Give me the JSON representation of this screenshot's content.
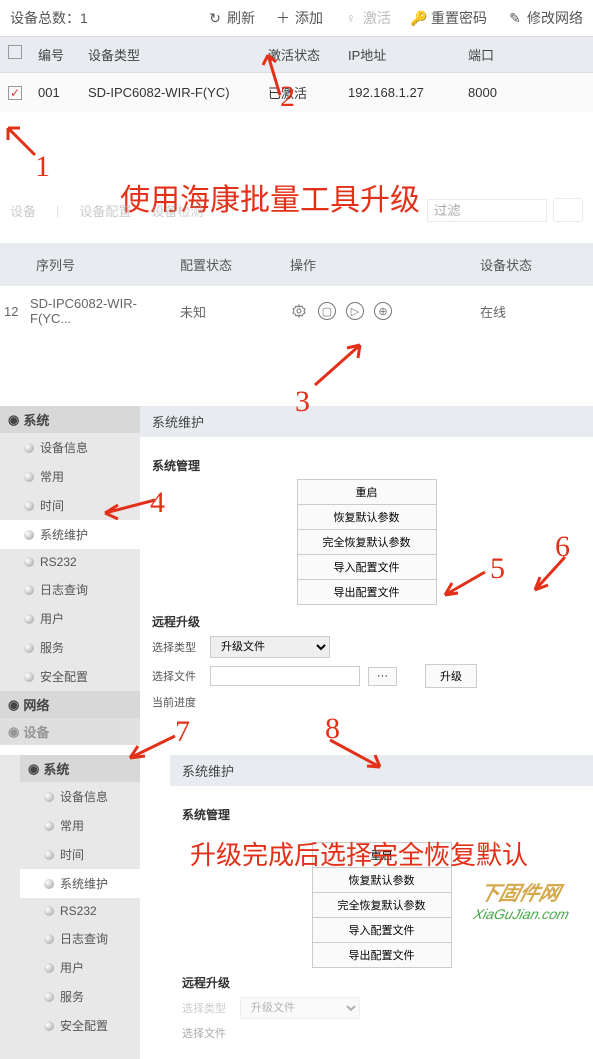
{
  "section1": {
    "total_label": "设备总数：",
    "total_value": "1",
    "toolbar": {
      "refresh": "刷新",
      "add": "添加",
      "activate": "激活",
      "reset_pwd": "重置密码",
      "modify_net": "修改网络"
    },
    "headers": {
      "num": "编号",
      "type": "设备类型",
      "status": "激活状态",
      "ip": "IP地址",
      "port": "端口"
    },
    "row": {
      "num": "001",
      "type": "SD-IPC6082-WIR-F(YC)",
      "status": "已激活",
      "ip": "192.168.1.27",
      "port": "8000"
    }
  },
  "annotations": {
    "title1": "使用海康批量工具升级",
    "title2": "升级完成后选择完全恢复默认",
    "n1": "1",
    "n2": "2",
    "n3": "3",
    "n4": "4",
    "n5": "5",
    "n6": "6",
    "n7": "7",
    "n8": "8"
  },
  "section2": {
    "toolbar": {
      "item1": "设备",
      "item2": "设备",
      "item3": "设备配置",
      "item4": "设备检测",
      "filter_label": "过滤"
    },
    "headers": {
      "serial": "序列号",
      "cfg": "配置状态",
      "ops": "操作",
      "dev": "设备状态"
    },
    "row": {
      "idx": "12",
      "serial": "SD-IPC6082-WIR-F(YC...",
      "cfg": "未知",
      "dev": "在线"
    }
  },
  "panel": {
    "group_system": "系统",
    "group_network": "网络",
    "group_other": "设备",
    "items": {
      "devinfo": "设备信息",
      "common": "常用",
      "time": "时间",
      "maint": "系统维护",
      "rs232": "RS232",
      "log": "日志查询",
      "user": "用户",
      "service": "服务",
      "security": "安全配置"
    },
    "content": {
      "title": "系统维护",
      "mgmt_title": "系统管理",
      "btns": {
        "reboot": "重启",
        "restore": "恢复默认参数",
        "full_restore": "完全恢复默认参数",
        "import": "导入配置文件",
        "export": "导出配置文件"
      },
      "upgrade_title": "远程升级",
      "select_type": "选择类型",
      "type_option": "升级文件",
      "select_file": "选择文件",
      "browse": "···",
      "upgrade": "升级",
      "progress": "当前进度"
    }
  },
  "watermark": {
    "line1": "下固件网",
    "line2": "XiaGuJian.com"
  }
}
